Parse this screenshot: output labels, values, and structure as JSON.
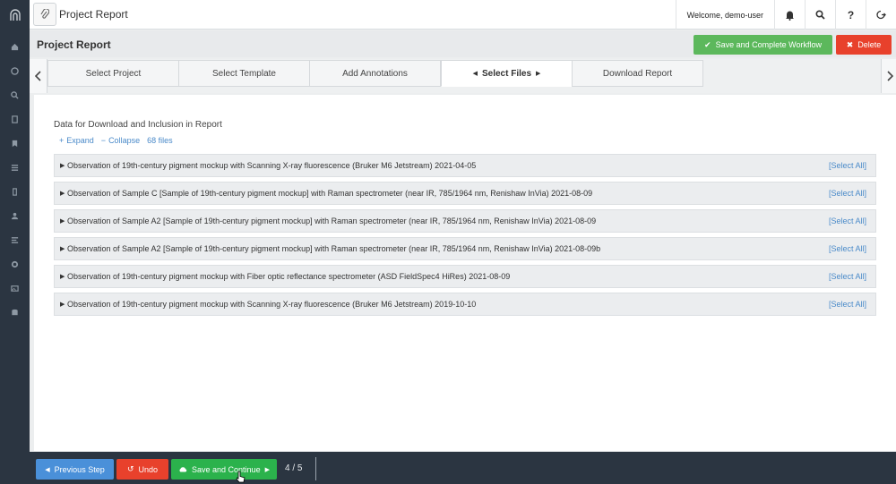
{
  "header": {
    "page_title": "Project Report",
    "welcome": "Welcome, demo-user"
  },
  "subheader": {
    "title": "Project Report",
    "complete_label": "Save and Complete Workflow",
    "delete_label": "Delete"
  },
  "tabs": [
    {
      "label": "Select Project",
      "active": false
    },
    {
      "label": "Select Template",
      "active": false
    },
    {
      "label": "Add Annotations",
      "active": false
    },
    {
      "label": "Select Files",
      "active": true
    },
    {
      "label": "Download Report",
      "active": false
    }
  ],
  "main": {
    "section_title": "Data for Download and Inclusion in Report",
    "expand_label": "Expand",
    "collapse_label": "Collapse",
    "file_count": "68 files",
    "select_all_label": "[Select All]",
    "observations": [
      "Observation of 19th-century pigment mockup with Scanning X-ray fluorescence (Bruker M6 Jetstream) 2021-04-05",
      "Observation of Sample C [Sample of 19th-century pigment mockup] with Raman spectrometer (near IR, 785/1964 nm, Renishaw InVia) 2021-08-09",
      "Observation of Sample A2 [Sample of 19th-century pigment mockup] with Raman spectrometer (near IR, 785/1964 nm, Renishaw InVia) 2021-08-09",
      "Observation of Sample A2 [Sample of 19th-century pigment mockup] with Raman spectrometer (near IR, 785/1964 nm, Renishaw InVia) 2021-08-09b",
      "Observation of 19th-century pigment mockup with Fiber optic reflectance spectrometer (ASD FieldSpec4 HiRes) 2021-08-09",
      "Observation of 19th-century pigment mockup with Scanning X-ray fluorescence (Bruker M6 Jetstream) 2019-10-10"
    ]
  },
  "footer": {
    "previous_label": "Previous Step",
    "undo_label": "Undo",
    "save_label": "Save and Continue",
    "step": "4 / 5"
  },
  "sidebar_icons": [
    "home-icon",
    "dashboard-icon",
    "search-icon",
    "document-icon",
    "bookmark-icon",
    "list-icon",
    "columns-icon",
    "user-icon",
    "lines-icon",
    "gear-icon",
    "image-icon",
    "database-icon"
  ],
  "colors": {
    "rail": "#2b3541",
    "success": "#5cb85c",
    "danger": "#e8412c",
    "primary": "#4a90d9",
    "link": "#4a8ac9"
  }
}
